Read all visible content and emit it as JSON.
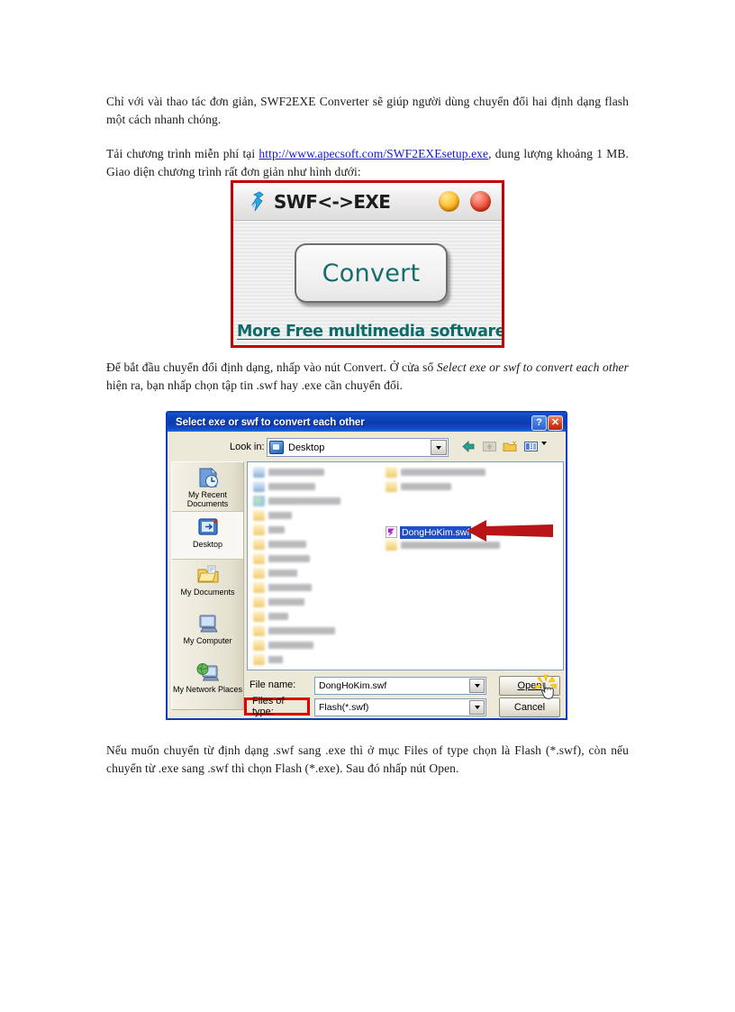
{
  "document": {
    "paragraph_intro": "Chỉ với vài thao tác đơn giản, SWF2EXE Converter sẽ giúp người dùng chuyển đổi hai định dạng flash một cách nhanh chóng.",
    "paragraph_download_before_link": "Tải chương trình miễn phí tại ",
    "download_link": "http://www.apecsoft.com/SWF2EXEsetup.exe",
    "paragraph_download_after_link": ", dung lượng khoảng 1 MB. Giao diện chương trình rất đơn giản như hình dưới:",
    "paragraph_start_part1": "Để bắt đầu chuyển đổi định dạng, nhấp vào nút Convert. Ở cửa sổ ",
    "paragraph_start_italic": "Select exe or swf to convert each other",
    "paragraph_start_part2": " hiện ra, bạn nhấp chọn tập tin .swf hay .exe cần chuyển đổi.",
    "paragraph_final": "Nếu muốn chuyển từ định dạng .swf sang .exe thì ở mục Files of type chọn là Flash (*.swf), còn nếu chuyển từ .exe sang .swf thì chọn Flash (*.exe). Sau đó nhấp nút Open."
  },
  "app_window": {
    "title": "SWF<->EXE",
    "logo_icon": "swf-exe-logo-icon",
    "minimize_button": "minimize-orb",
    "close_button": "close-orb",
    "convert_button_label": "Convert",
    "more_link_label": "More Free multimedia softwares...",
    "colors": {
      "border": "#c00000",
      "convert_text": "#176c6c",
      "link_text": "#0f6a6a",
      "minimize_orb": "#ffc83c",
      "close_orb": "#cc2b13"
    }
  },
  "file_dialog": {
    "title": "Select exe or swf to convert each other",
    "help_button_label": "?",
    "close_button_label": "✕",
    "lookin_label": "Look in:",
    "lookin_value": "Desktop",
    "toolbar_icons": [
      "back-icon",
      "up-one-level-icon",
      "new-folder-icon",
      "views-icon"
    ],
    "places": [
      {
        "label": "My Recent Documents",
        "icon": "recent-documents-icon",
        "selected": false
      },
      {
        "label": "Desktop",
        "icon": "desktop-icon",
        "selected": true
      },
      {
        "label": "My Documents",
        "icon": "my-documents-icon",
        "selected": false
      },
      {
        "label": "My Computer",
        "icon": "my-computer-icon",
        "selected": false
      },
      {
        "label": "My Network Places",
        "icon": "my-network-places-icon",
        "selected": false
      }
    ],
    "selected_file": "DongHoKim.swf",
    "selected_file_icon": "flash-swf-icon",
    "annotation_arrow": "red-arrow-pointing-at-selected-file",
    "filename_label": "File name:",
    "filename_value": "DongHoKim.swf",
    "filetype_label": "Files of type:",
    "filetype_value": "Flash(*.swf)",
    "filetype_label_highlight_color": "#e00000",
    "open_button_label": "Open",
    "cancel_button_label": "Cancel",
    "cursor": "hand-cursor-clicking-open",
    "colors": {
      "titlebar": "#0c3cae",
      "body": "#ece9d8",
      "selection": "#2050c8",
      "border": "#0b3fb5"
    }
  }
}
